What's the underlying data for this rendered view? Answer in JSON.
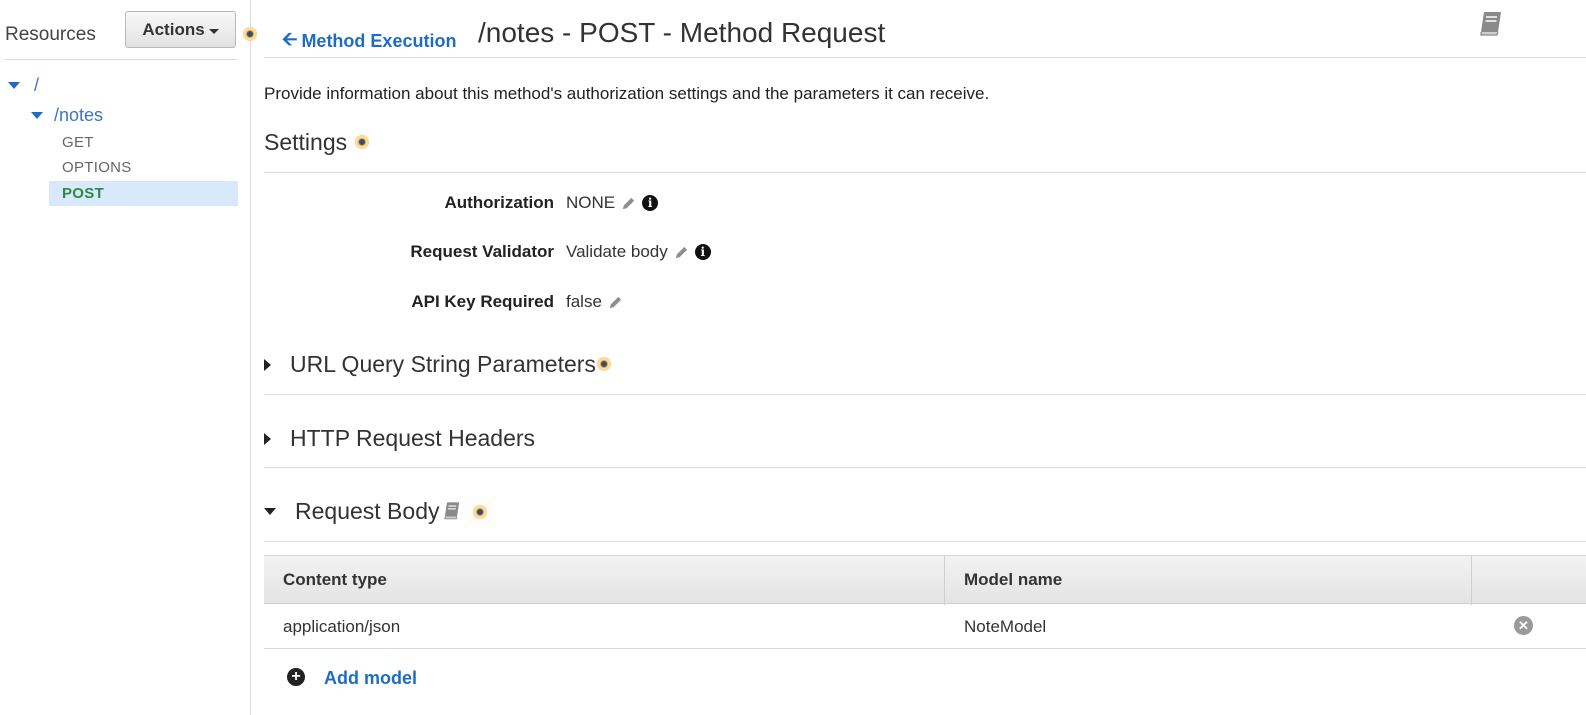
{
  "sidebar": {
    "title": "Resources",
    "actions_label": "Actions",
    "tree": {
      "root": "/",
      "resource": "/notes",
      "methods": [
        "GET",
        "OPTIONS",
        "POST"
      ],
      "selected": "POST"
    }
  },
  "header": {
    "back_label": "Method Execution",
    "title": "/notes - POST - Method Request"
  },
  "description": "Provide information about this method's authorization settings and the parameters it can receive.",
  "settings": {
    "title": "Settings",
    "rows": [
      {
        "label": "Authorization",
        "value": "NONE"
      },
      {
        "label": "Request Validator",
        "value": "Validate body"
      },
      {
        "label": "API Key Required",
        "value": "false"
      }
    ]
  },
  "sections": {
    "query": "URL Query String Parameters",
    "headers": "HTTP Request Headers",
    "body": "Request Body"
  },
  "request_body_table": {
    "columns": [
      "Content type",
      "Model name"
    ],
    "rows": [
      {
        "content_type": "application/json",
        "model_name": "NoteModel"
      }
    ],
    "add_label": "Add model"
  },
  "colors": {
    "link": "#1f6cc4",
    "selected_row": "#d7e9fb",
    "selected_method": "#2d8a43",
    "info_dot": "#f2a62a"
  }
}
